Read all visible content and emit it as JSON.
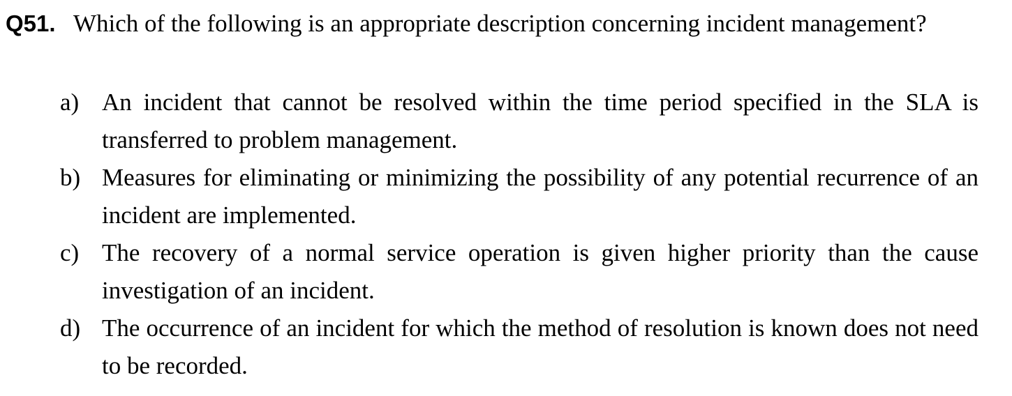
{
  "question": {
    "number": "Q51.",
    "text": "Which of the following is an appropriate description concerning incident management?"
  },
  "options": [
    {
      "letter": "a)",
      "text": "An incident that cannot be resolved within the time period specified in the SLA is transferred to problem management."
    },
    {
      "letter": "b)",
      "text": "Measures for eliminating or minimizing the possibility of any potential recurrence of an incident are implemented."
    },
    {
      "letter": "c)",
      "text": "The recovery of a normal service operation is given higher priority than the cause investigation of an incident."
    },
    {
      "letter": "d)",
      "text": "The occurrence of an incident for which the method of resolution is known does not need to be recorded."
    }
  ]
}
